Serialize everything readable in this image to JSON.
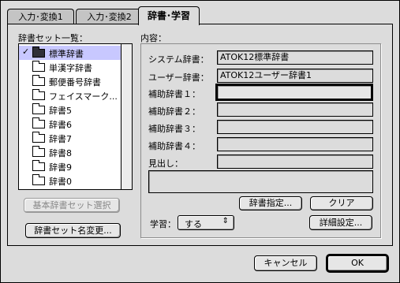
{
  "tabs": [
    {
      "label": "入力･変換1"
    },
    {
      "label": "入力･変換2"
    },
    {
      "label": "辞書･学習"
    }
  ],
  "left": {
    "list_title": "辞書セット一覧：",
    "items": [
      {
        "label": "標準辞書",
        "checked": "✓"
      },
      {
        "label": "単漢字辞書"
      },
      {
        "label": "郵便番号辞書"
      },
      {
        "label": "フェイスマーク..."
      },
      {
        "label": "辞書5"
      },
      {
        "label": "辞書6"
      },
      {
        "label": "辞書7"
      },
      {
        "label": "辞書8"
      },
      {
        "label": "辞書9"
      },
      {
        "label": "辞書0"
      }
    ],
    "basic_button": "基本辞書セット選択",
    "rename_button": "辞書セット名変更..."
  },
  "right": {
    "content_title": "内容：",
    "system_label": "システム辞書：",
    "system_value": "ATOK12標準辞書",
    "user_label": "ユーザー辞書：",
    "user_value": "ATOK12ユーザー辞書1",
    "aux1_label": "補助辞書１：",
    "aux2_label": "補助辞書２：",
    "aux3_label": "補助辞書３：",
    "aux4_label": "補助辞書４：",
    "heading_label": "見出し：",
    "dict_button": "辞書指定...",
    "clear_button": "クリア",
    "learn_label": "学習：",
    "learn_value": "する",
    "detail_button": "詳細設定..."
  },
  "footer": {
    "cancel": "キャンセル",
    "ok": "OK"
  }
}
